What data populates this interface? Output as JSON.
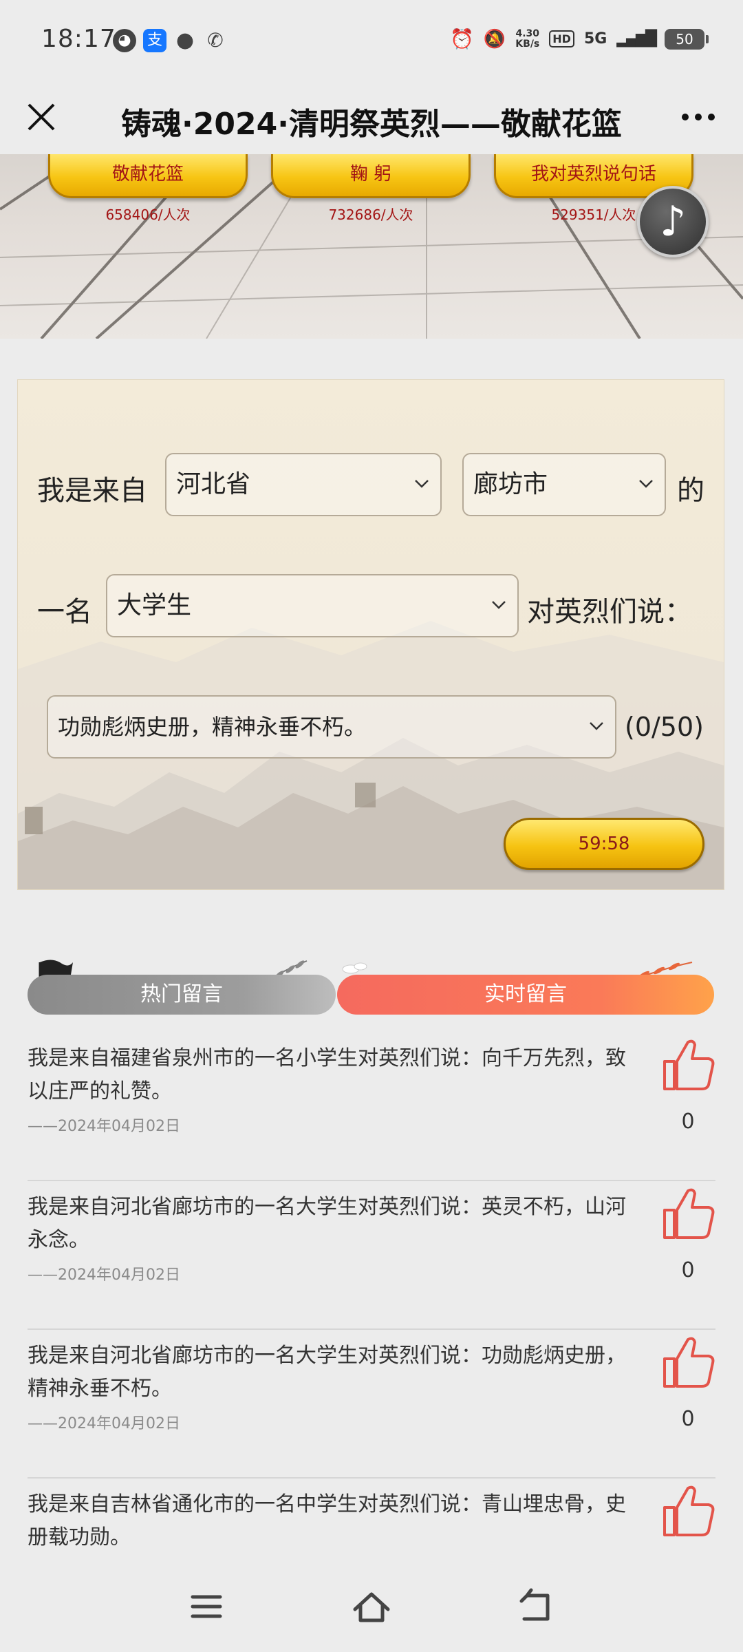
{
  "status_bar": {
    "time": "18:17",
    "net_speed_value": "4.30",
    "net_speed_unit": "KB/s",
    "hd_label": "HD",
    "network_label": "5G",
    "battery_level": "50"
  },
  "title_bar": {
    "title": "铸魂·2024·清明祭英烈——敬献花篮"
  },
  "banner": {
    "buttons": [
      {
        "label": "敬献花篮",
        "count": "658406/人次"
      },
      {
        "label": "鞠 躬",
        "count": "732686/人次"
      },
      {
        "label": "我对英烈说句话",
        "count": "529351/人次"
      }
    ]
  },
  "form": {
    "prefix": "我是来自",
    "province": "河北省",
    "city": "廊坊市",
    "connector": "的",
    "role_prefix": "一名",
    "role": "大学生",
    "role_suffix": "对英烈们说：",
    "message": "功勋彪炳史册，精神永垂不朽。",
    "char_count": "(0/50)",
    "submit_timer": "59:58"
  },
  "tabs": {
    "hot": "热门留言",
    "live": "实时留言",
    "active": "live"
  },
  "comments": [
    {
      "text": "我是来自福建省泉州市的一名小学生对英烈们说：向千万先烈，致以庄严的礼赞。",
      "date": "——2024年04月02日",
      "likes": "0"
    },
    {
      "text": "我是来自河北省廊坊市的一名大学生对英烈们说：英灵不朽，山河永念。",
      "date": "——2024年04月02日",
      "likes": "0"
    },
    {
      "text": "我是来自河北省廊坊市的一名大学生对英烈们说：功勋彪炳史册，精神永垂不朽。",
      "date": "——2024年04月02日",
      "likes": "0"
    },
    {
      "text": "我是来自吉林省通化市的一名中学生对英烈们说：青山埋忠骨，史册载功勋。",
      "date": "",
      "likes": ""
    }
  ],
  "colors": {
    "gold": "#f7c514",
    "gold_text": "#a31515",
    "active_tab": "#f56a5e",
    "like_icon": "#e3544a"
  },
  "icons": {
    "close": "close-icon",
    "more": "more-icon",
    "music": "music-note-icon",
    "like": "thumbs-up-icon",
    "nav": [
      "menu-icon",
      "home-icon",
      "back-icon"
    ]
  }
}
